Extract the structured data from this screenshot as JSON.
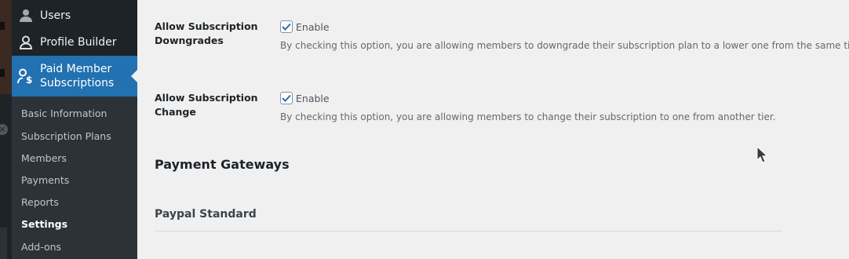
{
  "sidebar": {
    "menu": [
      {
        "label": "Users",
        "icon": "user-icon"
      },
      {
        "label": "Profile Builder",
        "icon": "profile-icon"
      },
      {
        "label": "Paid Member Subscriptions",
        "icon": "member-dollar-icon",
        "active": true
      }
    ],
    "submenu": [
      {
        "label": "Basic Information"
      },
      {
        "label": "Subscription Plans"
      },
      {
        "label": "Members"
      },
      {
        "label": "Payments"
      },
      {
        "label": "Reports"
      },
      {
        "label": "Settings",
        "current": true
      },
      {
        "label": "Add-ons"
      }
    ]
  },
  "settings": {
    "downgrades": {
      "label_line1": "Allow Subscription",
      "label_line2": "Downgrades",
      "checkbox_label": "Enable",
      "checked": true,
      "description": "By checking this option, you are allowing members to downgrade their subscription plan to a lower one from the same tier."
    },
    "change": {
      "label_line1": "Allow Subscription",
      "label_line2": "Change",
      "checkbox_label": "Enable",
      "checked": true,
      "description": "By checking this option, you are allowing members to change their subscription to one from another tier."
    }
  },
  "payment_gateways": {
    "section_title": "Payment Gateways",
    "gateway_title": "Paypal Standard"
  },
  "colors": {
    "sidebar_bg": "#1d2327",
    "submenu_bg": "#2c3338",
    "accent": "#2271b1",
    "content_bg": "#f0f0f1"
  }
}
